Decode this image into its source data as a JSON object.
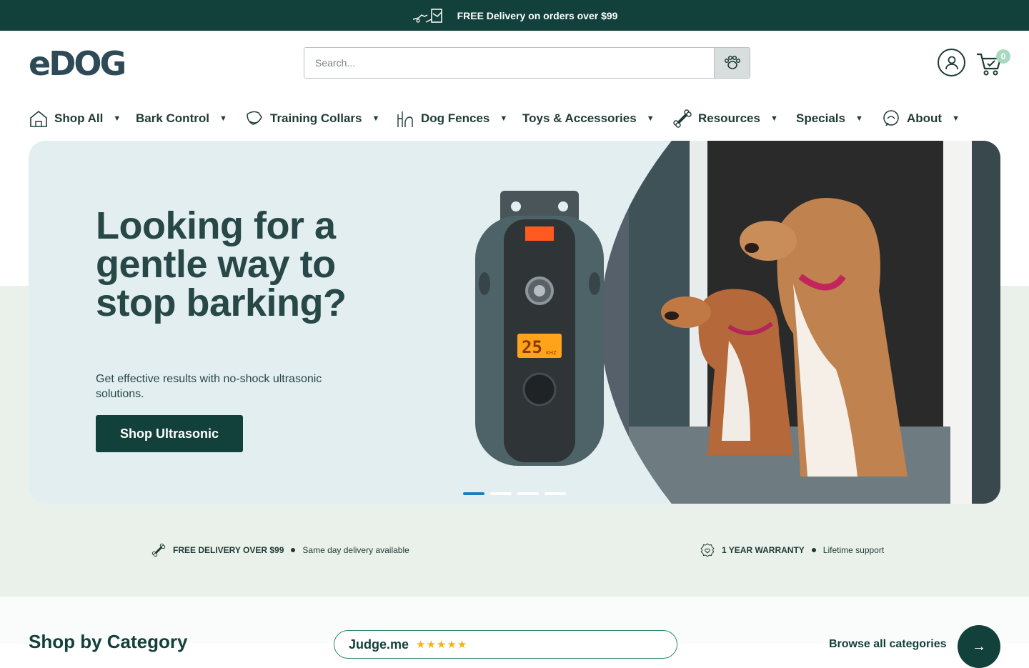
{
  "topbar": {
    "message": "FREE Delivery on orders over $99",
    "icon": "delivery-dog-icon"
  },
  "header": {
    "logo": "eDOG",
    "search_placeholder": "Search...",
    "search_icon": "paw-search-icon",
    "cart_count": "0"
  },
  "nav": {
    "items": [
      {
        "label": "Shop All",
        "icon": "house-icon"
      },
      {
        "label": "Bark Control",
        "icon": ""
      },
      {
        "label": "Training Collars",
        "icon": "dog-collar-icon"
      },
      {
        "label": "Dog Fences",
        "icon": "dog-fence-icon"
      },
      {
        "label": "Toys & Accessories",
        "icon": ""
      },
      {
        "label": "Resources",
        "icon": "bone-icon"
      },
      {
        "label": "Specials",
        "icon": ""
      },
      {
        "label": "About",
        "icon": "chat-dog-icon"
      }
    ]
  },
  "hero": {
    "title": "Looking for a gentle way to stop barking?",
    "subtitle": "Get effective results with no-shock ultrasonic solutions.",
    "cta": "Shop Ultrasonic",
    "slides": 4,
    "active_slide": 1,
    "device_display": "25",
    "device_unit": "KHZ"
  },
  "features": [
    {
      "title": "FREE DELIVERY OVER $99",
      "detail": "Same day delivery available",
      "icon": "bone-icon"
    },
    {
      "title": "1 YEAR WARRANTY",
      "detail": "Lifetime support",
      "icon": "badge-heart-icon"
    }
  ],
  "category": {
    "title": "Shop by Category",
    "review_brand": "Judge.me",
    "see_all": "Browse all categories"
  },
  "colors": {
    "primary": "#12403a",
    "accent": "#1b7fbf",
    "badge": "#a8d9c0"
  }
}
